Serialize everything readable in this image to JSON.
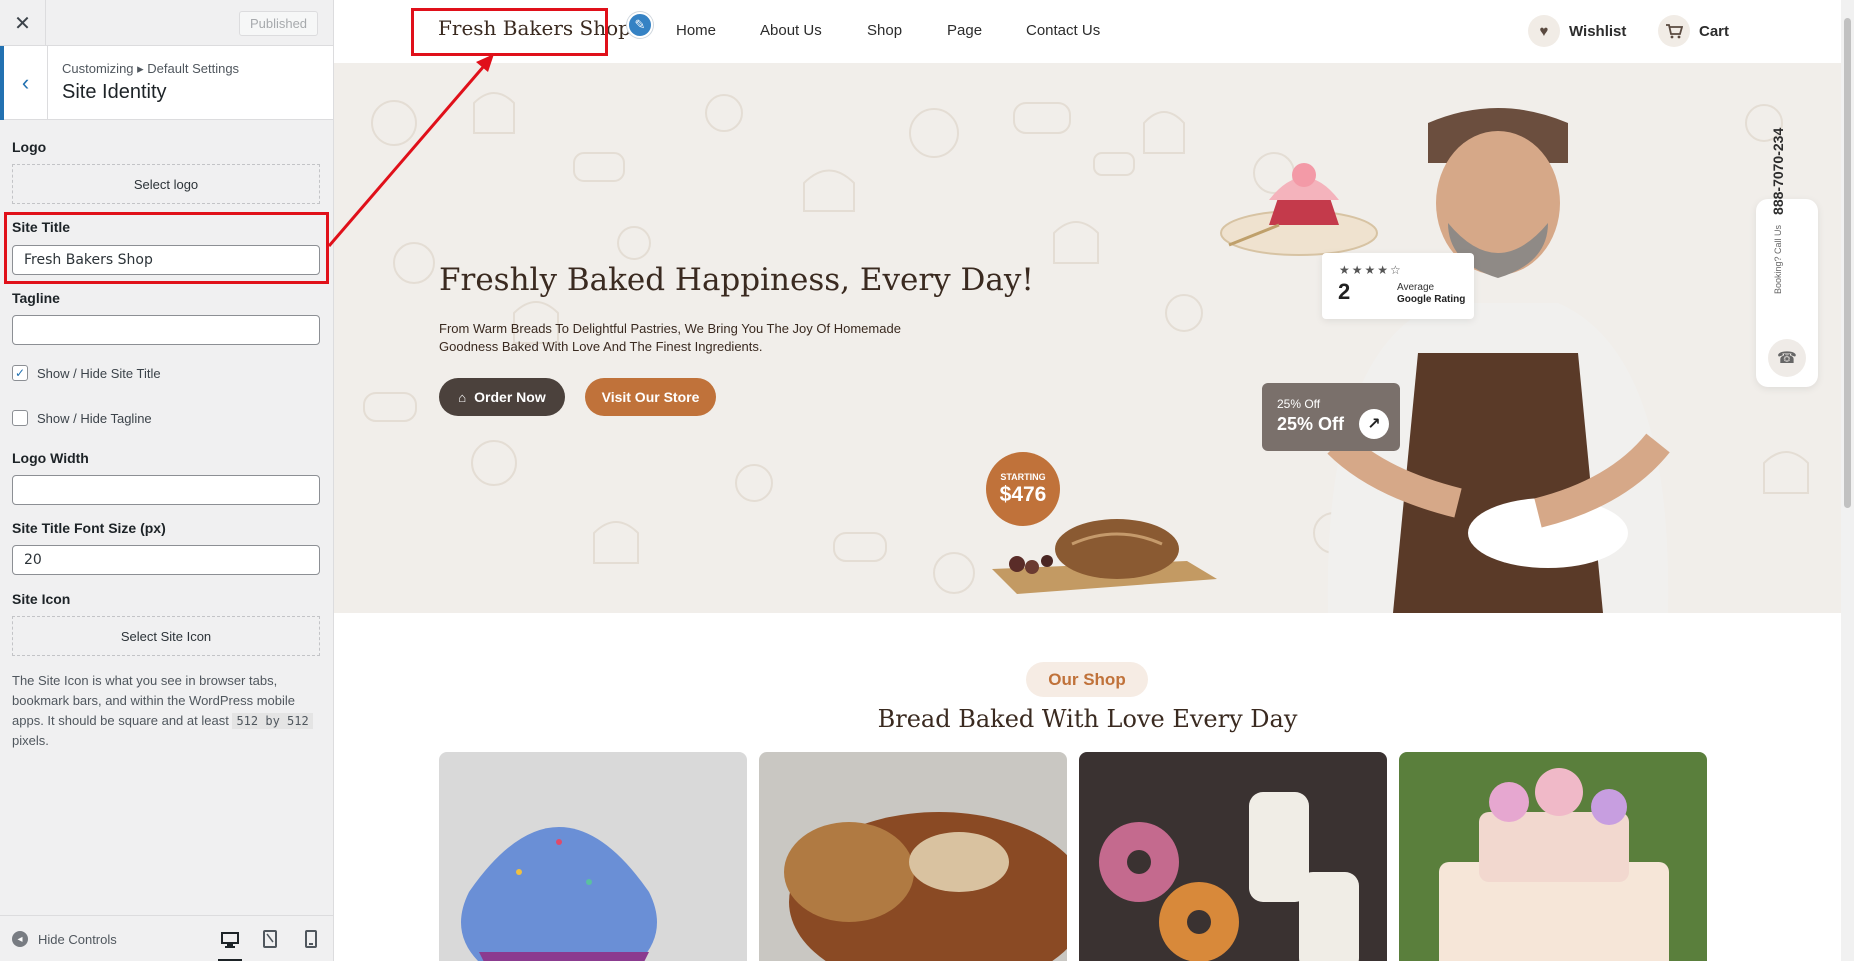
{
  "sidebar": {
    "close_glyph": "✕",
    "publish_label": "Published",
    "back_glyph": "‹",
    "breadcrumb": "Customizing ▸ Default Settings",
    "section_title": "Site Identity",
    "logo_label": "Logo",
    "select_logo_label": "Select logo",
    "site_title_label": "Site Title",
    "site_title_value": "Fresh Bakers Shop",
    "tagline_label": "Tagline",
    "tagline_value": "",
    "show_title_label": "Show / Hide Site Title",
    "show_title_checked": true,
    "show_tagline_label": "Show / Hide Tagline",
    "show_tagline_checked": false,
    "logo_width_label": "Logo Width",
    "logo_width_value": "",
    "font_size_label": "Site Title Font Size (px)",
    "font_size_value": "20",
    "site_icon_label": "Site Icon",
    "select_site_icon_label": "Select Site Icon",
    "site_icon_desc_pre": "The Site Icon is what you see in browser tabs, bookmark bars, and within the WordPress mobile apps. It should be square and at least",
    "site_icon_code": "512 by 512",
    "site_icon_desc_post": "pixels.",
    "hide_controls_label": "Hide Controls",
    "devices": [
      "desktop",
      "tablet",
      "mobile"
    ]
  },
  "preview": {
    "brand": "Fresh Bakers Shop",
    "nav": [
      "Home",
      "About Us",
      "Shop",
      "Page",
      "Contact Us"
    ],
    "wishlist_label": "Wishlist",
    "cart_label": "Cart",
    "hero_title": "Freshly Baked Happiness, Every Day!",
    "hero_desc": "From Warm Breads To Delightful Pastries, We Bring You The Joy Of Homemade Goodness Baked With Love And The Finest Ingredients.",
    "order_now": "Order Now",
    "visit_store": "Visit Our Store",
    "price_small": "STARTING",
    "price_big": "$476",
    "rating_stars": 4,
    "rating_value": "2",
    "rating_avg": "Average",
    "rating_source": "Google Rating",
    "off_small": "25% Off",
    "off_big": "25% Off",
    "call_label": "Booking? Call Us",
    "call_number": "888-7070-234",
    "shop_pill": "Our Shop",
    "shop_title": "Bread Baked With Love Every Day"
  },
  "colors": {
    "accent": "#c0723a",
    "dark_button": "#4b413c",
    "wp_blue": "#2271b1",
    "highlight": "#e0101a",
    "hero_bg": "#f1eeea"
  },
  "icons": [
    "close-icon",
    "chevron-left-icon",
    "checkmark-icon",
    "pencil-icon",
    "heart-icon",
    "cart-icon",
    "cake-icon",
    "arrow-up-right-icon",
    "phone-icon",
    "eye-icon",
    "desktop-icon",
    "tablet-icon",
    "mobile-icon"
  ]
}
